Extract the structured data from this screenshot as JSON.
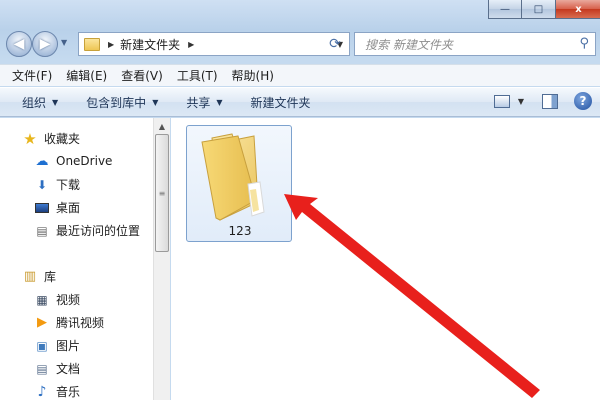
{
  "window": {
    "caption_buttons": {
      "minimize": "—",
      "maximize": "□",
      "close": "x"
    }
  },
  "address_bar": {
    "crumb": "新建文件夹",
    "search_placeholder": "搜索 新建文件夹"
  },
  "menu": [
    "文件(F)",
    "编辑(E)",
    "查看(V)",
    "工具(T)",
    "帮助(H)"
  ],
  "toolbar": {
    "organize": "组织",
    "include_in_library": "包含到库中",
    "share": "共享",
    "new_folder": "新建文件夹",
    "help": "?"
  },
  "navigation": {
    "favorites": {
      "label": "收藏夹",
      "items": [
        {
          "label": "OneDrive",
          "icon": "cloud-icon"
        },
        {
          "label": "下载",
          "icon": "download-folder-icon"
        },
        {
          "label": "桌面",
          "icon": "desktop-icon"
        },
        {
          "label": "最近访问的位置",
          "icon": "recent-places-icon"
        }
      ]
    },
    "libraries": {
      "label": "库",
      "items": [
        {
          "label": "视频",
          "icon": "video-icon"
        },
        {
          "label": "腾讯视频",
          "icon": "tencent-video-icon"
        },
        {
          "label": "图片",
          "icon": "pictures-icon"
        },
        {
          "label": "文档",
          "icon": "documents-icon"
        },
        {
          "label": "音乐",
          "icon": "music-icon"
        }
      ]
    }
  },
  "content": {
    "items": [
      {
        "name": "123",
        "type": "folder",
        "selected": true
      }
    ]
  },
  "colors": {
    "annotation_arrow": "#e8201c",
    "selection_border": "#7da2ce"
  }
}
